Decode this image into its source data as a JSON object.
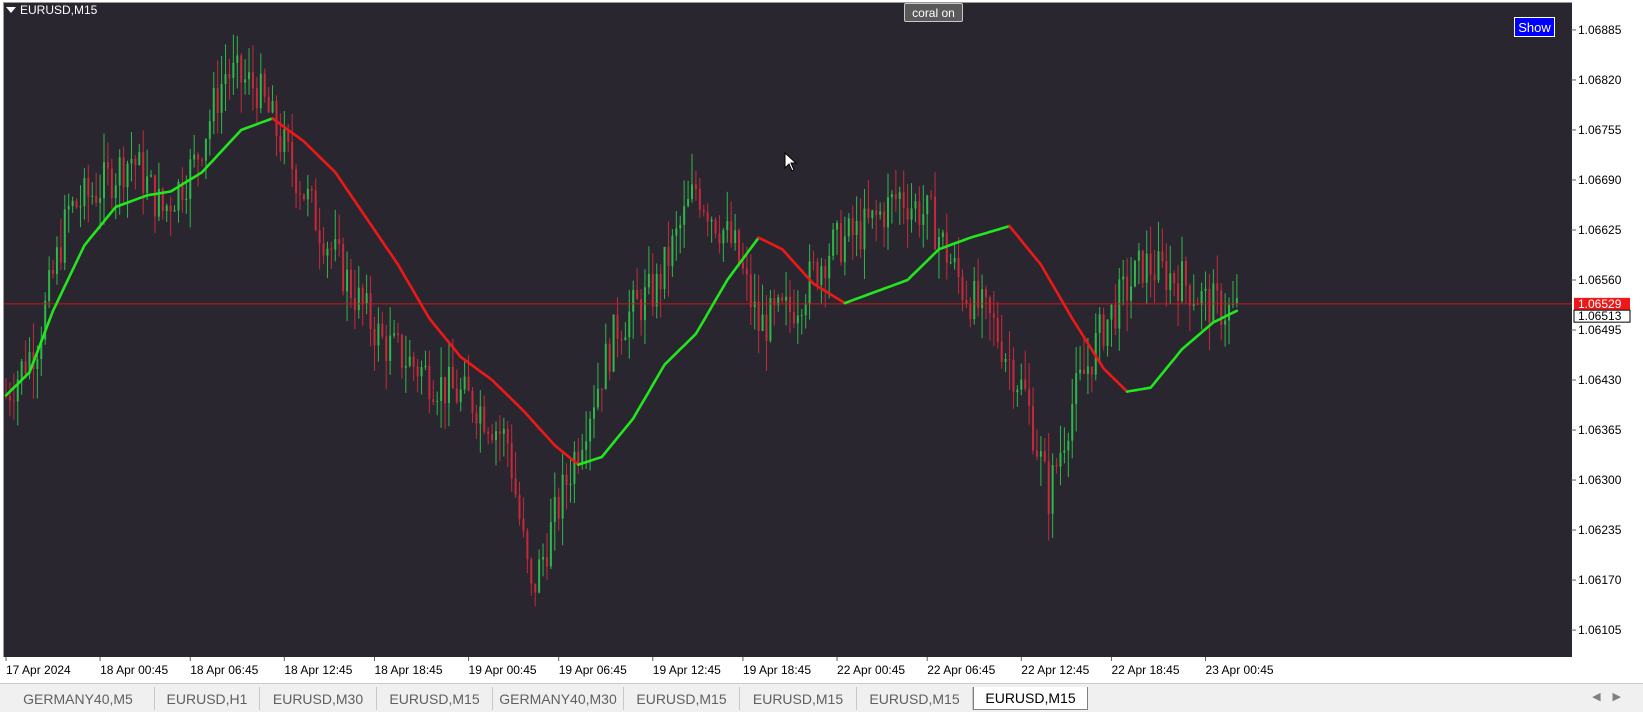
{
  "window": {
    "symbol_label": "EURUSD,M15"
  },
  "buttons": {
    "coral": "coral on",
    "show": "Show"
  },
  "price_labels": {
    "current_bid": "1.06529",
    "current_other": "1.06513"
  },
  "tabs": [
    {
      "label": "GERMANY40,M5",
      "active": false
    },
    {
      "label": "EURUSD,H1",
      "active": false
    },
    {
      "label": "EURUSD,M30",
      "active": false
    },
    {
      "label": "EURUSD,M15",
      "active": false
    },
    {
      "label": "GERMANY40,M30",
      "active": false
    },
    {
      "label": "EURUSD,M15",
      "active": false
    },
    {
      "label": "EURUSD,M15",
      "active": false
    },
    {
      "label": "EURUSD,M15",
      "active": false
    },
    {
      "label": "EURUSD,M15",
      "active": true
    }
  ],
  "tab_scroll": {
    "left": "◀",
    "right": "▶"
  },
  "colors": {
    "background": "#2a2630",
    "bull_candle": "#2db84a",
    "bear_candle": "#c42a3a",
    "coral_up": "#22e61e",
    "coral_down": "#ef1818",
    "price_line": "#c81818",
    "bid_label": "#ef1818"
  },
  "chart_data": {
    "type": "candlestick",
    "ylim": [
      1.0607,
      1.0692
    ],
    "y_ticks": [
      "1.06885",
      "1.06820",
      "1.06755",
      "1.06690",
      "1.06625",
      "1.06560",
      "1.06495",
      "1.06430",
      "1.06365",
      "1.06300",
      "1.06235",
      "1.06170",
      "1.06105"
    ],
    "x_ticks": [
      "17 Apr 2024",
      "18 Apr 00:45",
      "18 Apr 06:45",
      "18 Apr 12:45",
      "18 Apr 18:45",
      "19 Apr 00:45",
      "19 Apr 06:45",
      "19 Apr 12:45",
      "19 Apr 18:45",
      "22 Apr 00:45",
      "22 Apr 06:45",
      "22 Apr 12:45",
      "22 Apr 18:45",
      "23 Apr 00:45"
    ],
    "current_price": 1.06529,
    "close_path": [
      [
        0,
        1.0641
      ],
      [
        8,
        1.0648
      ],
      [
        16,
        1.0665
      ],
      [
        24,
        1.0668
      ],
      [
        32,
        1.0672
      ],
      [
        40,
        1.0665
      ],
      [
        48,
        1.0671
      ],
      [
        56,
        1.0683
      ],
      [
        64,
        1.0681
      ],
      [
        72,
        1.0672
      ],
      [
        80,
        1.0663
      ],
      [
        88,
        1.0655
      ],
      [
        96,
        1.0648
      ],
      [
        104,
        1.0645
      ],
      [
        112,
        1.0642
      ],
      [
        120,
        1.064
      ],
      [
        128,
        1.0635
      ],
      [
        134,
        1.0615
      ],
      [
        140,
        1.0625
      ],
      [
        148,
        1.0638
      ],
      [
        156,
        1.065
      ],
      [
        166,
        1.0655
      ],
      [
        176,
        1.0668
      ],
      [
        186,
        1.066
      ],
      [
        192,
        1.065
      ],
      [
        200,
        1.0652
      ],
      [
        210,
        1.066
      ],
      [
        220,
        1.0663
      ],
      [
        228,
        1.0667
      ],
      [
        236,
        1.0664
      ],
      [
        244,
        1.0655
      ],
      [
        252,
        1.065
      ],
      [
        260,
        1.0641
      ],
      [
        266,
        1.0628
      ],
      [
        272,
        1.064
      ],
      [
        280,
        1.065
      ],
      [
        290,
        1.0658
      ],
      [
        300,
        1.0656
      ],
      [
        306,
        1.0653
      ],
      [
        312,
        1.0652
      ]
    ],
    "coral_path": [
      [
        0,
        1.0641
      ],
      [
        6,
        1.0644
      ],
      [
        12,
        1.0652
      ],
      [
        20,
        1.06605
      ],
      [
        28,
        1.06655
      ],
      [
        36,
        1.0667
      ],
      [
        42,
        1.06675
      ],
      [
        50,
        1.067
      ],
      [
        60,
        1.06755
      ],
      [
        68,
        1.0677
      ],
      [
        76,
        1.0674
      ],
      [
        84,
        1.067
      ],
      [
        92,
        1.0664
      ],
      [
        100,
        1.0658
      ],
      [
        108,
        1.0651
      ],
      [
        116,
        1.0646
      ],
      [
        124,
        1.0643
      ],
      [
        132,
        1.0639
      ],
      [
        140,
        1.06345
      ],
      [
        146,
        1.0632
      ],
      [
        152,
        1.0633
      ],
      [
        160,
        1.0638
      ],
      [
        168,
        1.0645
      ],
      [
        176,
        1.0649
      ],
      [
        184,
        1.0656
      ],
      [
        192,
        1.06615
      ],
      [
        198,
        1.066
      ],
      [
        206,
        1.06555
      ],
      [
        214,
        1.0653
      ],
      [
        222,
        1.06545
      ],
      [
        230,
        1.0656
      ],
      [
        238,
        1.066
      ],
      [
        246,
        1.06615
      ],
      [
        256,
        1.0663
      ],
      [
        264,
        1.0658
      ],
      [
        272,
        1.0651
      ],
      [
        280,
        1.06445
      ],
      [
        286,
        1.06415
      ],
      [
        292,
        1.0642
      ],
      [
        300,
        1.0647
      ],
      [
        308,
        1.06505
      ],
      [
        314,
        1.0652
      ]
    ],
    "coral_color_segments": [
      {
        "from": 0,
        "to": 37,
        "trend": "up"
      },
      {
        "from": 37,
        "to": 48,
        "trend": "up"
      },
      {
        "from": 48,
        "to": 68,
        "trend": "up"
      },
      {
        "from": 68,
        "to": 146,
        "trend": "down"
      },
      {
        "from": 146,
        "to": 192,
        "trend": "up"
      },
      {
        "from": 192,
        "to": 214,
        "trend": "down"
      },
      {
        "from": 214,
        "to": 256,
        "trend": "up"
      },
      {
        "from": 256,
        "to": 286,
        "trend": "down"
      },
      {
        "from": 286,
        "to": 314,
        "trend": "up"
      }
    ]
  }
}
